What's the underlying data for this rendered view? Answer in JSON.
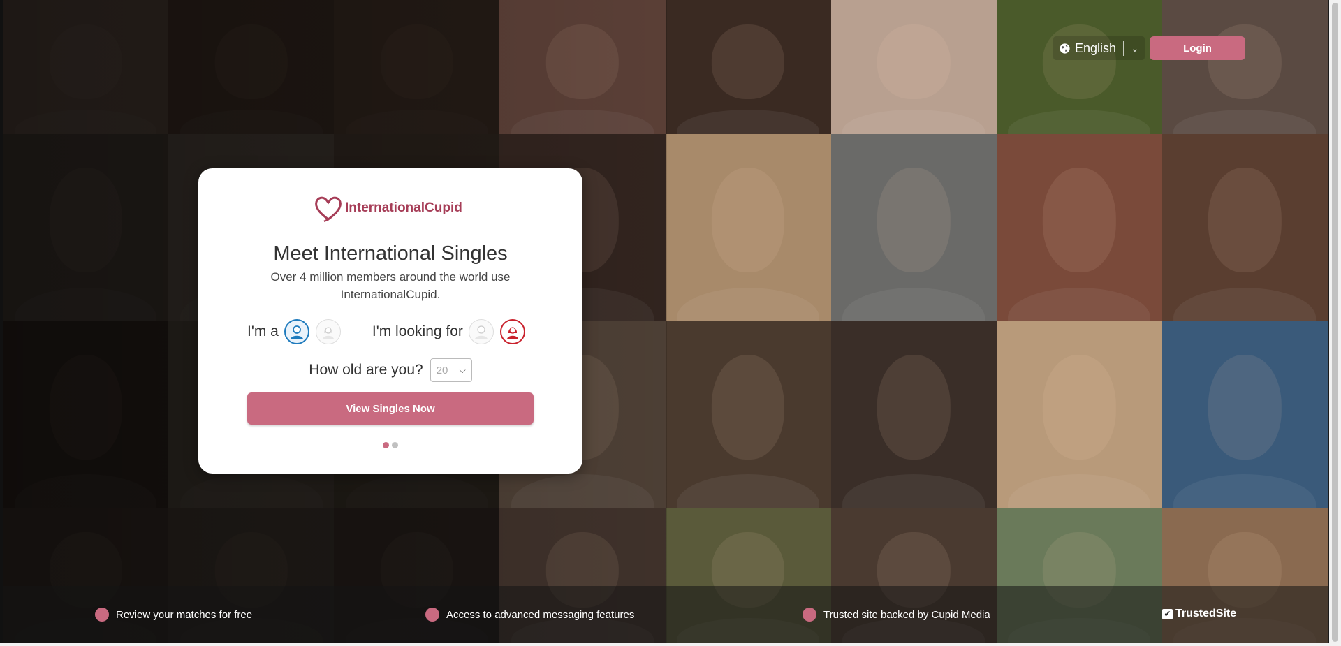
{
  "header": {
    "language": "English",
    "login_label": "Login"
  },
  "card": {
    "brand_name": "InternationalCupid",
    "headline": "Meet International Singles",
    "subheadline": "Over 4 million members around the world use InternationalCupid.",
    "iam_label": "I'm a",
    "looking_for_label": "I'm looking for",
    "iam_selected": "male",
    "looking_for_selected": "female",
    "age_question": "How old are you?",
    "age_value": "20",
    "cta_label": "View Singles Now",
    "carousel_pages": 2,
    "carousel_active": 1
  },
  "features": [
    "Review your matches for free",
    "Access to advanced messaging features",
    "Trusted site backed by Cupid Media"
  ],
  "badge": {
    "label": "TrustedSite"
  },
  "colors": {
    "brand": "#c96a80",
    "brand_text": "#a63d57",
    "male_accent": "#1f7bbd",
    "female_accent": "#c9212c"
  }
}
